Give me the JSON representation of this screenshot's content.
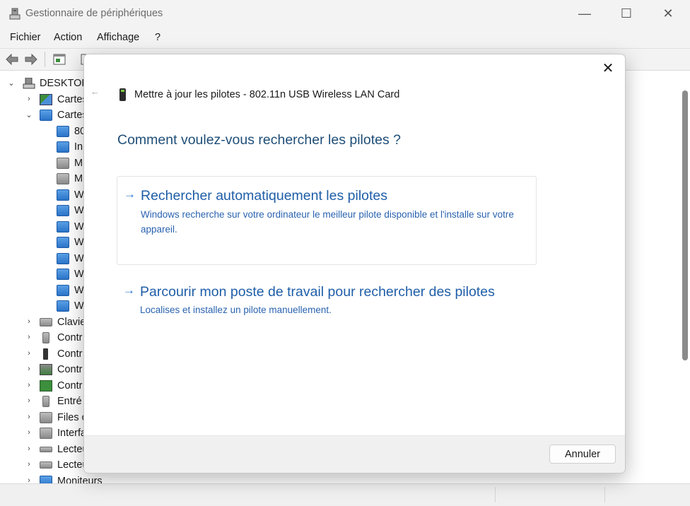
{
  "window": {
    "title": "Gestionnaire de périphériques",
    "minimize": "—",
    "maximize": "☐",
    "close": "✕"
  },
  "menu": [
    "Fichier",
    "Action",
    "Affichage",
    "?"
  ],
  "tree": {
    "root_label": "DESKTOP",
    "rows": [
      {
        "label": "Cartes",
        "icon": "display-adapter-icon",
        "chevron": "›"
      },
      {
        "label": "Cartes",
        "icon": "network-adapter-icon",
        "chevron": "⌄"
      },
      {
        "label": "80",
        "icon": "network-adapter-icon"
      },
      {
        "label": "In",
        "icon": "network-adapter-icon"
      },
      {
        "label": "M",
        "icon": "network-adapter-disabled-icon"
      },
      {
        "label": "M",
        "icon": "network-adapter-disabled-icon"
      },
      {
        "label": "W",
        "icon": "network-adapter-icon"
      },
      {
        "label": "W",
        "icon": "network-adapter-icon"
      },
      {
        "label": "W",
        "icon": "network-adapter-icon"
      },
      {
        "label": "W",
        "icon": "network-adapter-icon"
      },
      {
        "label": "W",
        "icon": "network-adapter-icon"
      },
      {
        "label": "W",
        "icon": "network-adapter-icon"
      },
      {
        "label": "W",
        "icon": "network-adapter-icon"
      },
      {
        "label": "W",
        "icon": "network-adapter-icon"
      },
      {
        "label": "Clavie",
        "icon": "keyboard-icon",
        "chevron": "›"
      },
      {
        "label": "Contr",
        "icon": "audio-icon",
        "chevron": "›"
      },
      {
        "label": "Contr",
        "icon": "usb-icon",
        "chevron": "›"
      },
      {
        "label": "Contr",
        "icon": "storage-controller-icon",
        "chevron": "›"
      },
      {
        "label": "Contr",
        "icon": "ide-controller-icon",
        "chevron": "›"
      },
      {
        "label": "Entré",
        "icon": "audio-input-icon",
        "chevron": "›"
      },
      {
        "label": "Files c",
        "icon": "print-queue-icon",
        "chevron": "›"
      },
      {
        "label": "Interfa",
        "icon": "hid-icon",
        "chevron": "›"
      },
      {
        "label": "Lecteu",
        "icon": "disk-drive-icon",
        "chevron": "›"
      },
      {
        "label": "Lecteu",
        "icon": "dvd-drive-icon",
        "chevron": "›"
      },
      {
        "label": "Moniteurs",
        "icon": "monitor-icon",
        "chevron": "›"
      }
    ]
  },
  "dialog": {
    "header_title": "Mettre à jour les pilotes - 802.11n USB Wireless LAN Card",
    "question": "Comment voulez-vous rechercher les pilotes ?",
    "option1": {
      "arrow": "→",
      "title": "Rechercher automatiquement les pilotes",
      "description": "Windows recherche sur votre ordinateur le meilleur pilote disponible et l'installe sur votre appareil."
    },
    "option2": {
      "arrow": "→",
      "title": "Parcourir mon poste de travail pour rechercher des pilotes",
      "description": "Localises et installez un pilote manuellement."
    },
    "cancel_label": "Annuler",
    "close_glyph": "✕",
    "back_glyph": "←"
  }
}
